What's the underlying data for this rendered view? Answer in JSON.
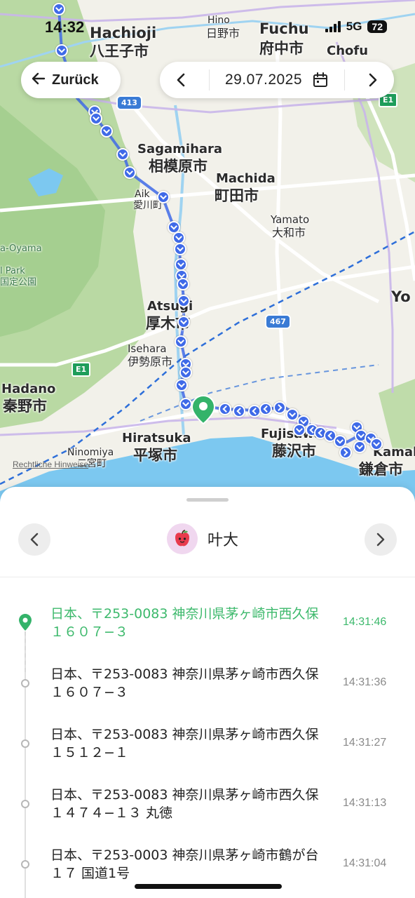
{
  "status_bar": {
    "time": "14:32",
    "network": "5G",
    "battery": "72"
  },
  "header": {
    "back_label": "Zurück",
    "date": "29.07.2025"
  },
  "map": {
    "labels": {
      "hachioji_en": "Hachioji",
      "hachioji_jp": "八王子市",
      "hino_en": "Hino",
      "hino_jp": "日野市",
      "fuchu_en": "Fuchu",
      "fuchu_jp": "府中市",
      "chofu": "Chofu",
      "sagamihara_en": "Sagamihara",
      "sagamihara_jp": "相模原市",
      "machida_en": "Machida",
      "machida_jp": "町田市",
      "aikawa_en": "Aik",
      "aikawa_jp": "愛川町",
      "yamato_en": "Yamato",
      "yamato_jp": "大和市",
      "oyama": "a-Oyama",
      "park": "l Park",
      "park_jp": "国定公園",
      "atsugi_en": "Atsugi",
      "atsugi_jp": "厚木市",
      "isehara_en": "Isehara",
      "isehara_jp": "伊勢原市",
      "hadano_en": "Hadano",
      "hadano_jp": "秦野市",
      "hiratsuka_en": "Hiratsuka",
      "hiratsuka_jp": "平塚市",
      "ninomiya_en": "Ninomiya",
      "ninomiya_jp": "二宮町",
      "fujisawa_en": "Fujisawa",
      "fujisawa_jp": "藤沢市",
      "kamakura_en": "Kamaku",
      "kamakura_jp": "鎌倉市",
      "yokohama": "Yo"
    },
    "shields": {
      "r413": "413",
      "r467": "467",
      "e1a": "E1",
      "e1b": "E1"
    },
    "credit": "Rechtliche Hinweise",
    "colors": {
      "route": "#3f6ae8",
      "pin": "#34b36a",
      "water": "#7cc8f0",
      "forest": "#b7d9a5",
      "road": "#ffffff",
      "rail": "#2e6fd9"
    }
  },
  "person": {
    "name": "叶大",
    "avatar_icon": "apple-face-icon"
  },
  "timeline": [
    {
      "address": "日本、〒253-0083 神奈川県茅ヶ崎市西久保１６０７−３",
      "time": "14:31:46",
      "active": true
    },
    {
      "address": "日本、〒253-0083 神奈川県茅ヶ崎市西久保１６０７−３",
      "time": "14:31:36",
      "active": false
    },
    {
      "address": "日本、〒253-0083 神奈川県茅ヶ崎市西久保１５１２−１",
      "time": "14:31:27",
      "active": false
    },
    {
      "address": "日本、〒253-0083 神奈川県茅ヶ崎市西久保１４７４−１３ 丸徳",
      "time": "14:31:13",
      "active": false
    },
    {
      "address": "日本、〒253-0003 神奈川県茅ヶ崎市鶴が台１７ 国道1号",
      "time": "14:31:04",
      "active": false
    }
  ]
}
